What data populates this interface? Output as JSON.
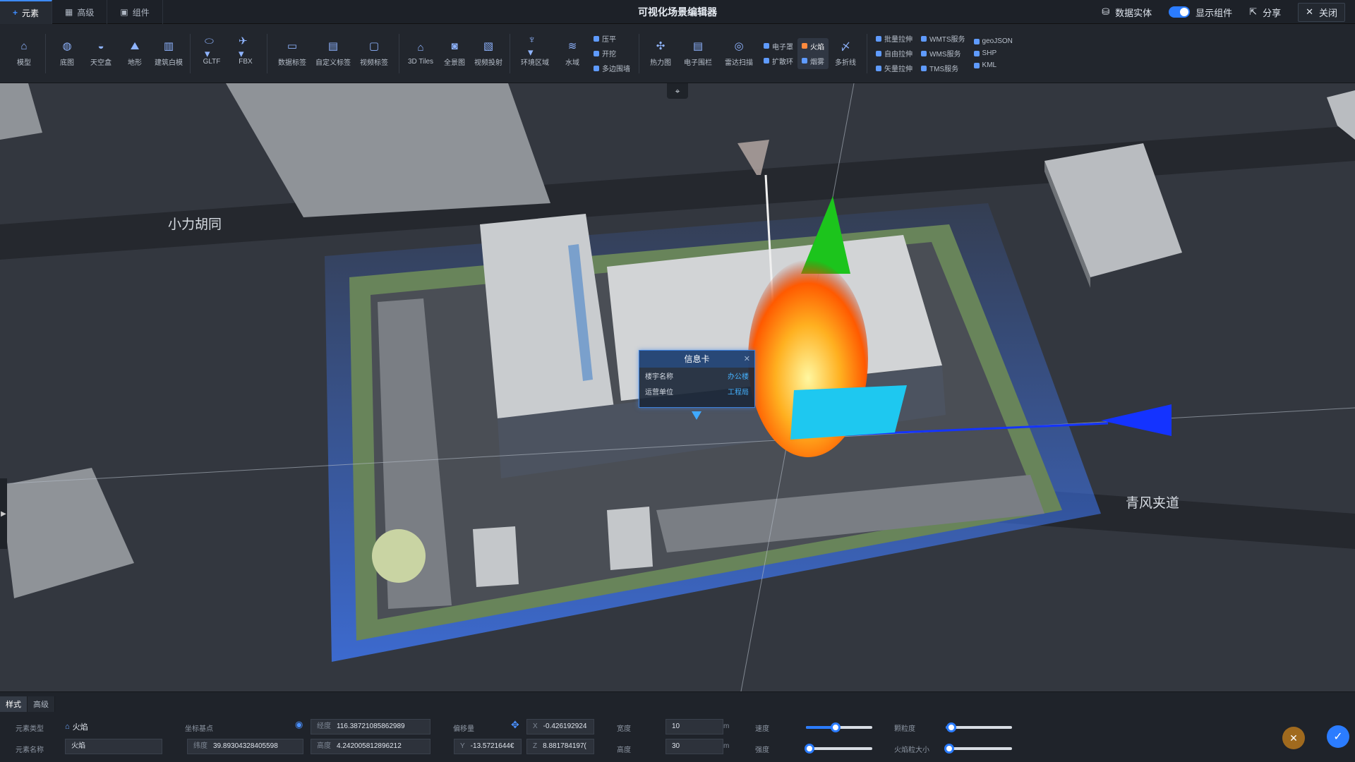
{
  "app": {
    "title": "可视化场景编辑器"
  },
  "tabs": [
    {
      "label": "元素",
      "icon": "plus-icon",
      "active": true
    },
    {
      "label": "高级",
      "icon": "grid-icon",
      "active": false
    },
    {
      "label": "组件",
      "icon": "component-icon",
      "active": false
    }
  ],
  "top_right": {
    "data_entity": "数据实体",
    "show_component": "显示组件",
    "share": "分享",
    "close": "关闭"
  },
  "toolbar": {
    "tools": [
      {
        "label": "模型",
        "icon": "building-icon"
      },
      {
        "label": "底图",
        "icon": "globe-icon"
      },
      {
        "label": "天空盒",
        "icon": "sky-icon"
      },
      {
        "label": "地形",
        "icon": "terrain-icon"
      },
      {
        "label": "建筑白模",
        "icon": "white-model-icon"
      },
      {
        "label": "GLTF",
        "icon": "gltf-icon"
      },
      {
        "label": "FBX",
        "icon": "fbx-icon"
      },
      {
        "label": "数据标签",
        "icon": "data-label-icon"
      },
      {
        "label": "自定义标签",
        "icon": "custom-label-icon"
      },
      {
        "label": "视频标签",
        "icon": "video-label-icon"
      },
      {
        "label": "3D Tiles",
        "icon": "tiles-icon"
      },
      {
        "label": "全景图",
        "icon": "panorama-icon"
      },
      {
        "label": "视频投射",
        "icon": "video-projection-icon"
      },
      {
        "label": "环境区域",
        "icon": "environment-icon"
      },
      {
        "label": "水域",
        "icon": "water-icon"
      }
    ],
    "col_a": [
      "压平",
      "开挖",
      "多边围墙"
    ],
    "tools2": [
      {
        "label": "热力图",
        "icon": "heatmap-icon"
      },
      {
        "label": "电子围栏",
        "icon": "fence-icon"
      },
      {
        "label": "雷达扫描",
        "icon": "radar-icon"
      }
    ],
    "col_b": [
      "电子罩",
      "扩散环"
    ],
    "col_c": [
      "火焰",
      "烟雾"
    ],
    "tool_polyline": {
      "label": "多折线",
      "icon": "polyline-icon"
    },
    "col_d": [
      "批量拉伸",
      "自由拉伸",
      "矢量拉伸"
    ],
    "col_e": [
      "WMTS服务",
      "WMS服务",
      "TMS服务"
    ],
    "col_f": [
      "geoJSON",
      "SHP",
      "KML"
    ]
  },
  "map": {
    "road_1": "小力胡同",
    "road_2": "青风夹道"
  },
  "info_card": {
    "title": "信息卡",
    "rows": [
      {
        "key": "楼宇名称",
        "value": "办公楼"
      },
      {
        "key": "运营单位",
        "value": "工程局"
      }
    ]
  },
  "bottom": {
    "tabs": [
      "样式",
      "高级"
    ],
    "element_type_label": "元素类型",
    "element_type_value": "火焰",
    "element_name_label": "元素名称",
    "element_name_value": "火焰",
    "coord_label": "坐标基点",
    "longitude_label": "经度",
    "longitude": "116.38721085862989",
    "latitude_label": "纬度",
    "latitude": "39.89304328405598",
    "height_label": "高度",
    "height": "4.242005812896212",
    "offset_label": "偏移量",
    "x": "-0.426192924",
    "y": "-13.5721644€",
    "z": "8.881784197(",
    "x_label": "X",
    "y_label": "Y",
    "z_label": "Z",
    "width_label": "宽度",
    "width": "10",
    "height2_label": "高度",
    "height2": "30",
    "unit": "m",
    "speed_label": "速度",
    "speed": 0.45,
    "strength_label": "强度",
    "strength": 0.05,
    "opacity_label": "颗粒度",
    "opacity": 0.08,
    "flame_size_label": "火焰粒大小",
    "flame_size": 0.05
  }
}
